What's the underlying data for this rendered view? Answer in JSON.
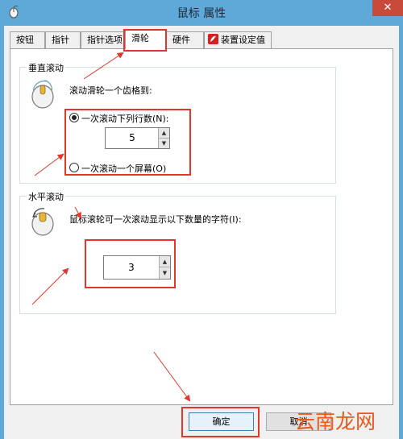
{
  "window": {
    "title": "鼠标 属性",
    "close_glyph": "✕"
  },
  "tabs": [
    {
      "label": "按钮"
    },
    {
      "label": "指针"
    },
    {
      "label": "指针选项"
    },
    {
      "label": "滑轮",
      "active": true
    },
    {
      "label": "硬件"
    },
    {
      "label": "装置设定值"
    }
  ],
  "vertical_scroll": {
    "title": "垂直滚动",
    "prompt": "滚动滑轮一个齿格到:",
    "option_lines": "一次滚动下列行数(N):",
    "lines_value": "5",
    "option_screen": "一次滚动一个屏幕(O)",
    "selected": "lines"
  },
  "horizontal_scroll": {
    "title": "水平滚动",
    "prompt": "鼠标滚轮可一次滚动显示以下数量的字符(I):",
    "chars_value": "3"
  },
  "buttons": {
    "ok": "确定",
    "cancel": "取消"
  },
  "watermark": "云南龙网",
  "colors": {
    "titlebar": "#5ea9d8",
    "annotation_red": "#e0362c",
    "close_button": "#c74a3b"
  }
}
